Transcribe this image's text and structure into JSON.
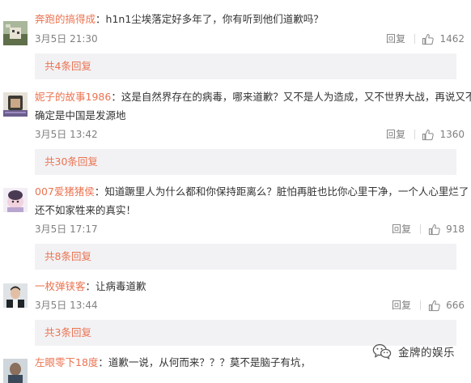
{
  "comments": [
    {
      "username": "奔跑的搞得成",
      "separator": "：",
      "content": "h1n1尘埃落定好多年了，你有听到他们道歉吗？",
      "time": "3月5日 21:30",
      "reply_label": "回复",
      "likes": "1462",
      "replies_label": "共4条回复"
    },
    {
      "username": "妮子的故事1986",
      "separator": "：",
      "content": "这是自然界存在的病毒，哪来道歉？又不是人为造成，又不世界大战，再说又不",
      "content_line2": "确定是中国是发源地",
      "time": "3月5日 13:42",
      "reply_label": "回复",
      "likes": "1360",
      "replies_label": "共30条回复"
    },
    {
      "username": "007爱猪猪侯",
      "separator": "：",
      "content": "知道蹶里人为什么都和你保持距离么？脏怕再脏也比你心里干净，一个人心里烂了",
      "content_line2": "还不如家牲来的真实！",
      "time": "3月5日 17:17",
      "reply_label": "回复",
      "likes": "918",
      "replies_label": "共8条回复"
    },
    {
      "username": "一枚弹铗客",
      "separator": "：",
      "content": "让病毒道歉",
      "time": "3月5日 13:44",
      "reply_label": "回复",
      "likes": "666",
      "replies_label": "共3条回复"
    },
    {
      "username": "左眼零下18度",
      "separator": "：",
      "content": "道歉一说，从何而来？？？莫不是脑子有坑，"
    }
  ],
  "watermark": {
    "text": "金牌的娱乐",
    "icon": "wechat-icon"
  },
  "colors": {
    "accent": "#eb7350",
    "text": "#333333",
    "meta": "#808080",
    "reply_box": "#f2f2f5"
  }
}
